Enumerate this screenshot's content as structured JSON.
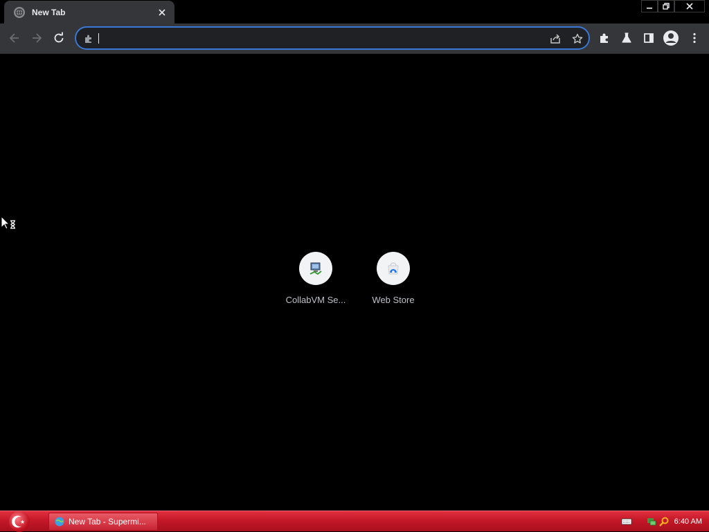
{
  "browser": {
    "tab": {
      "title": "New Tab",
      "close_icon": "close-icon",
      "favicon": "globe-icon"
    },
    "window_controls": {
      "minimize": "minimize-icon",
      "restore": "restore-icon",
      "close": "close-icon"
    },
    "toolbar": {
      "back": "arrow-left-icon",
      "forward": "arrow-right-icon",
      "reload": "reload-icon",
      "extensions": "puzzle-icon",
      "labs": "flask-icon",
      "side_panel": "side-panel-icon",
      "profile": "profile-icon",
      "menu": "kebab-menu-icon"
    },
    "omnibox": {
      "value": "",
      "placeholder": "",
      "site_icon": "puzzle-piece-icon",
      "share": "share-icon",
      "bookmark": "star-icon",
      "focus_color": "#3a78d6"
    }
  },
  "new_tab_page": {
    "shortcuts": [
      {
        "label": "CollabVM Se...",
        "icon": "collabvm-icon"
      },
      {
        "label": "Web Store",
        "icon": "web-store-icon"
      }
    ]
  },
  "taskbar": {
    "start_icon": "start-orb-icon",
    "items": [
      {
        "label": "New Tab - Supermi...",
        "icon": "browser-icon"
      }
    ],
    "tray": {
      "icons": [
        "keyboard-icon",
        "network-icon",
        "search-icon"
      ],
      "clock": "6:40 AM"
    },
    "color": "#c41828"
  },
  "theme": {
    "background": "#000000",
    "toolbar": "#35363a",
    "accent": "#3a78d6"
  }
}
